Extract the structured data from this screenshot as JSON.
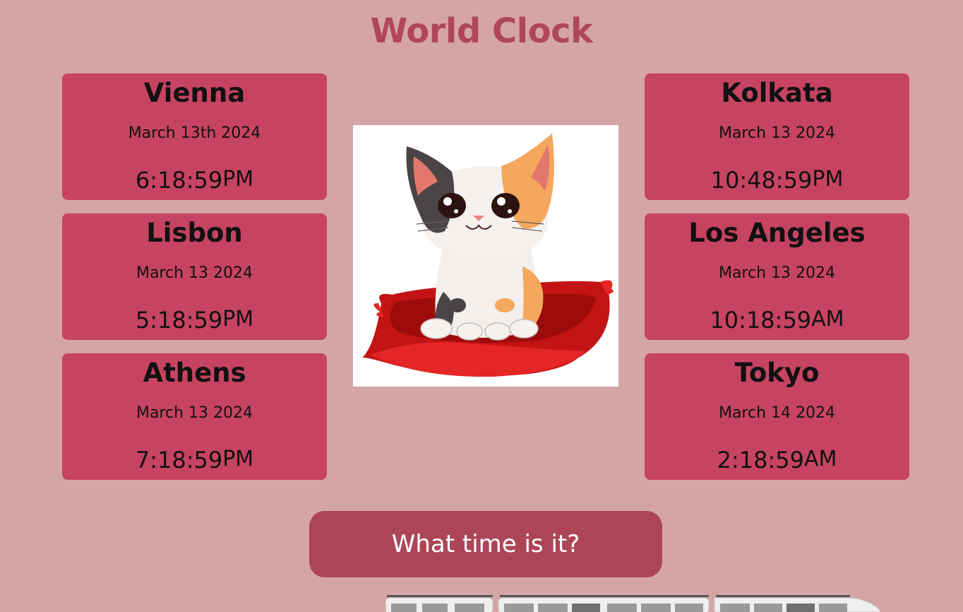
{
  "page": {
    "title": "World Clock",
    "button_label": "What time is it?"
  },
  "clocks": [
    {
      "city": "Vienna",
      "date": "March 13th 2024",
      "time": "6:18:59",
      "ampm": "PM"
    },
    {
      "city": "Lisbon",
      "date": "March 13 2024",
      "time": "5:18:59",
      "ampm": "PM"
    },
    {
      "city": "Athens",
      "date": "March 13 2024",
      "time": "7:18:59",
      "ampm": "PM"
    },
    {
      "city": "Kolkata",
      "date": "March 13 2024",
      "time": "10:48:59",
      "ampm": "PM"
    },
    {
      "city": "Los Angeles",
      "date": "March 13 2024",
      "time": "10:18:59",
      "ampm": "AM"
    },
    {
      "city": "Tokyo",
      "date": "March 14 2024",
      "time": "2:18:59",
      "ampm": "AM"
    }
  ],
  "images": {
    "center": "calico-kitten-on-red-cushion",
    "footer": "white-train"
  },
  "colors": {
    "background": "#d5a5a6",
    "title": "#b0465a",
    "card": "#c74362",
    "button": "#ac4657"
  }
}
